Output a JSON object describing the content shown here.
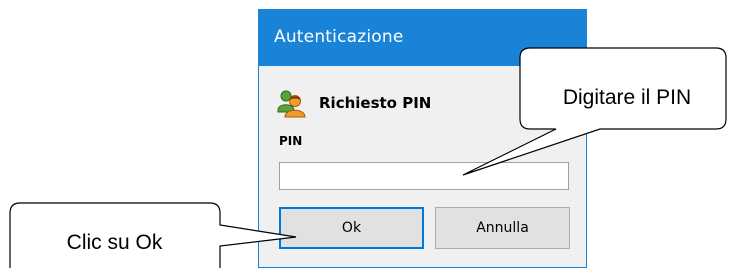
{
  "dialog": {
    "title": "Autenticazione",
    "heading": "Richiesto PIN",
    "pin_label": "PIN",
    "pin_value": "",
    "ok_label": "Ok",
    "cancel_label": "Annulla",
    "icon": "user-pin-icon",
    "colors": {
      "titlebar": "#1883d7",
      "body": "#f0f0f0",
      "focus_border": "#0078d7"
    }
  },
  "callouts": {
    "pin_hint": "Digitare il PIN",
    "ok_hint": "Clic su Ok"
  }
}
